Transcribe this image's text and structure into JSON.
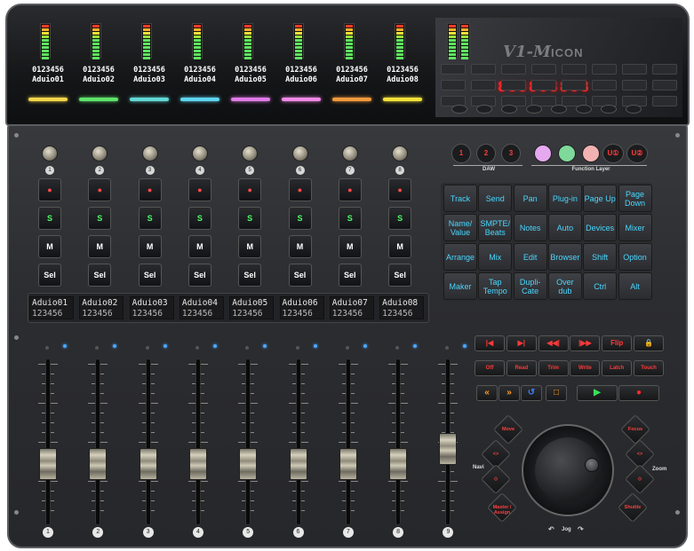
{
  "channels": [
    {
      "num": "1",
      "top_id": "0123456",
      "top_name": "Aduio01",
      "color": "#f2d54a",
      "scribble_name": "Aduio01",
      "scribble_id": "123456"
    },
    {
      "num": "2",
      "top_id": "0123456",
      "top_name": "Aduio02",
      "color": "#5fe36b",
      "scribble_name": "Aduio02",
      "scribble_id": "123456"
    },
    {
      "num": "3",
      "top_id": "0123456",
      "top_name": "Aduio03",
      "color": "#62d9d6",
      "scribble_name": "Aduio03",
      "scribble_id": "123456"
    },
    {
      "num": "4",
      "top_id": "0123456",
      "top_name": "Aduio04",
      "color": "#5fd6f0",
      "scribble_name": "Aduio04",
      "scribble_id": "123456"
    },
    {
      "num": "5",
      "top_id": "0123456",
      "top_name": "Aduio05",
      "color": "#e07ce8",
      "scribble_name": "Aduio05",
      "scribble_id": "123456"
    },
    {
      "num": "6",
      "top_id": "0123456",
      "top_name": "Aduio06",
      "color": "#f08ae6",
      "scribble_name": "Aduio06",
      "scribble_id": "123456"
    },
    {
      "num": "7",
      "top_id": "0123456",
      "top_name": "Aduio07",
      "color": "#f09a3c",
      "scribble_name": "Aduio07",
      "scribble_id": "123456"
    },
    {
      "num": "8",
      "top_id": "0123456",
      "top_name": "Aduio08",
      "color": "#f2e23a",
      "scribble_name": "Aduio08",
      "scribble_id": "123456"
    }
  ],
  "master_fader_num": "9",
  "strip_buttons": {
    "rec": "●",
    "solo": "S",
    "mute": "M",
    "select": "Sel"
  },
  "brand": {
    "logo": "V1-M",
    "sub": "ICON",
    "display": "888888888"
  },
  "daw": {
    "label": "DAW",
    "buttons": [
      "1",
      "2",
      "3"
    ]
  },
  "function_layer": {
    "label": "Function Layer",
    "colors": [
      "#e6a8ef",
      "#7fd99a",
      "#f3b2b2"
    ],
    "u1": "U①",
    "u2": "U②"
  },
  "grid_buttons": [
    "Track",
    "Send",
    "Pan",
    "Plug-in",
    "Page Up",
    "Page Down",
    "Name/ Value",
    "SMPTE/ Beats",
    "Notes",
    "Auto",
    "Devices",
    "Mixer",
    "Arrange",
    "Mix",
    "Edit",
    "Browser",
    "Shift",
    "Option",
    "Maker",
    "Tap Tempo",
    "Dupli- Cate",
    "Over dub",
    "Ctrl",
    "Alt"
  ],
  "transport_row1": [
    "|◀",
    "▶|",
    "◀◀|",
    "|▶▶",
    "Flip",
    "🔒"
  ],
  "transport_row2": [
    "Off",
    "Read",
    "Trim",
    "Write",
    "Latch",
    "Touch"
  ],
  "transport_row3": [
    "«",
    "»",
    "↺",
    "□",
    "▶",
    "●"
  ],
  "transport_row3_colors": [
    "#ff9a2a",
    "#ff9a2a",
    "#3a7cff",
    "#ff9a2a",
    "#3adf5a",
    "#ff2a2a"
  ],
  "nav": {
    "move": "Move",
    "left_arrows": "<>",
    "updown": "◇",
    "master": "Master / Assign",
    "navi": "Navi"
  },
  "zoom": {
    "focus": "Focus",
    "right_arrows": "<>",
    "updown": "◇",
    "shuttle": "Shuttle",
    "zoom": "Zoom"
  },
  "jog_label": "Jog"
}
